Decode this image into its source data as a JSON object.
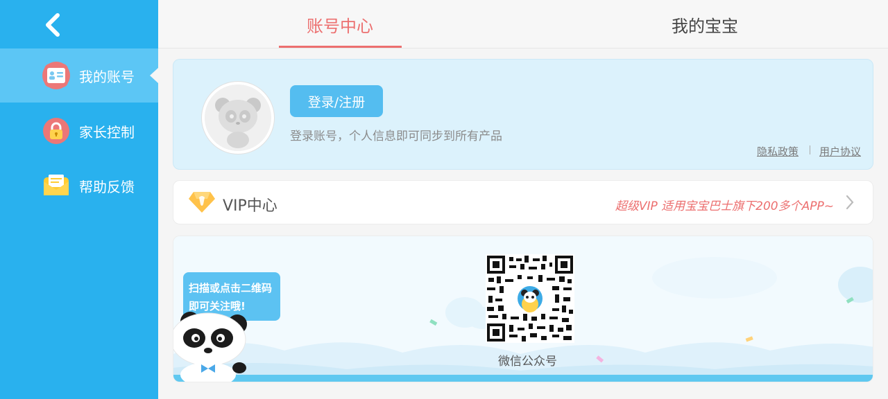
{
  "sidebar": {
    "items": [
      {
        "label": "我的账号",
        "icon": "profile-card-icon",
        "active": true
      },
      {
        "label": "家长控制",
        "icon": "lock-icon"
      },
      {
        "label": "帮助反馈",
        "icon": "envelope-icon"
      }
    ]
  },
  "tabs": [
    {
      "label": "账号中心",
      "active": true
    },
    {
      "label": "我的宝宝"
    }
  ],
  "account": {
    "login_button": "登录/注册",
    "sync_text": "登录账号，个人信息即可同步到所有产品",
    "privacy_link": "隐私政策",
    "agreement_link": "用户协议"
  },
  "vip": {
    "title": "VIP中心",
    "promo": "超级VIP 适用宝宝巴士旗下200多个APP~"
  },
  "qr": {
    "bubble_line1": "扫描或点击二维码",
    "bubble_line2": "即可关注哦!",
    "caption": "微信公众号"
  },
  "colors": {
    "sidebar": "#29b1ee",
    "accent": "#ec6f6f",
    "button": "#54bdf0"
  }
}
